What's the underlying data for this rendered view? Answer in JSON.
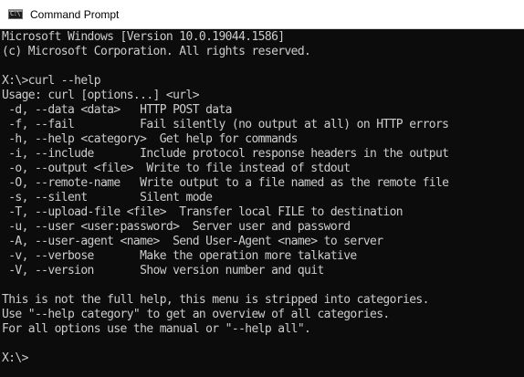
{
  "window": {
    "title": "Command Prompt",
    "icon": "cmd-icon",
    "icon_glyph": "C:\\",
    "colors": {
      "console_background": "#0c0c0c",
      "console_text": "#cccccc",
      "titlebar_background": "#ffffff"
    }
  },
  "console": {
    "lines": [
      "Microsoft Windows [Version 10.0.19044.1586]",
      "(c) Microsoft Corporation. All rights reserved.",
      "",
      "X:\\>curl --help",
      "Usage: curl [options...] <url>",
      " -d, --data <data>   HTTP POST data",
      " -f, --fail          Fail silently (no output at all) on HTTP errors",
      " -h, --help <category>  Get help for commands",
      " -i, --include       Include protocol response headers in the output",
      " -o, --output <file>  Write to file instead of stdout",
      " -O, --remote-name   Write output to a file named as the remote file",
      " -s, --silent        Silent mode",
      " -T, --upload-file <file>  Transfer local FILE to destination",
      " -u, --user <user:password>  Server user and password",
      " -A, --user-agent <name>  Send User-Agent <name> to server",
      " -v, --verbose       Make the operation more talkative",
      " -V, --version       Show version number and quit",
      "",
      "This is not the full help, this menu is stripped into categories.",
      "Use \"--help category\" to get an overview of all categories.",
      "For all options use the manual or \"--help all\".",
      "",
      "X:\\>"
    ]
  }
}
